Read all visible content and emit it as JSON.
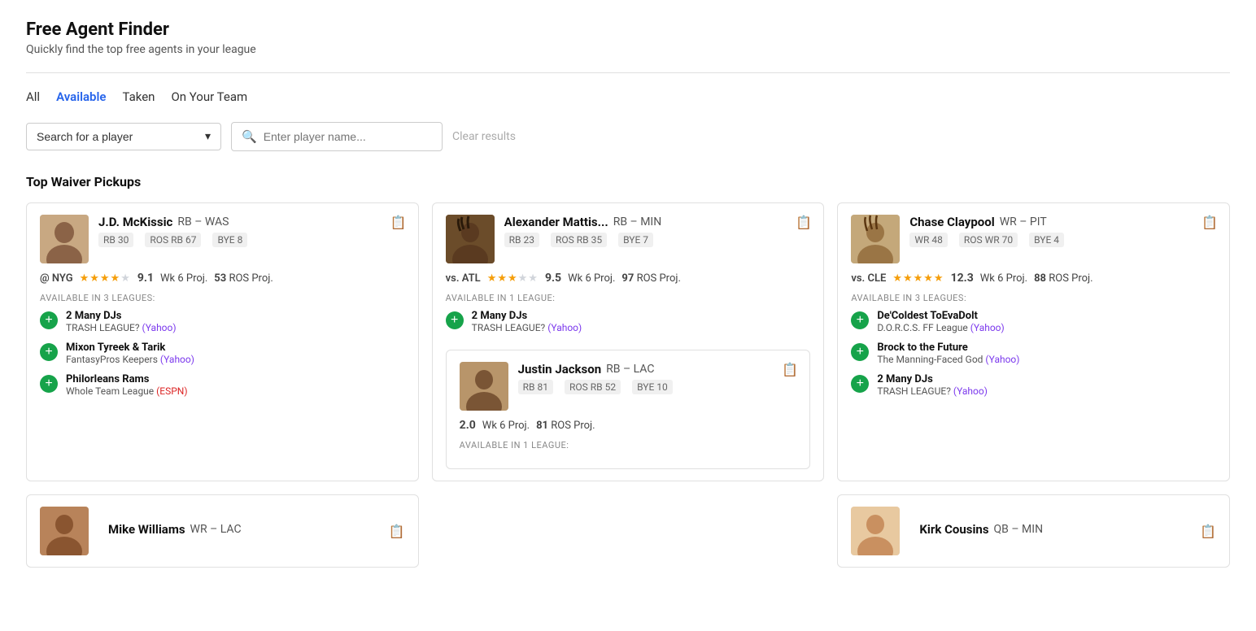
{
  "page": {
    "title": "Free Agent Finder",
    "subtitle": "Quickly find the top free agents in your league"
  },
  "filters": {
    "tabs": [
      {
        "id": "all",
        "label": "All",
        "active": false
      },
      {
        "id": "available",
        "label": "Available",
        "active": true
      },
      {
        "id": "taken",
        "label": "Taken",
        "active": false
      },
      {
        "id": "on-your-team",
        "label": "On Your Team",
        "active": false
      }
    ]
  },
  "search": {
    "player_select_placeholder": "Search for a player",
    "player_name_placeholder": "Enter player name...",
    "clear_label": "Clear results"
  },
  "section": {
    "top_waiver_title": "Top Waiver Pickups"
  },
  "cards": [
    {
      "id": "jd-mckissic",
      "name": "J.D. McKissic",
      "pos": "RB",
      "team": "WAS",
      "stats": [
        "RB 30",
        "ROS RB 67",
        "BYE 8"
      ],
      "matchup": "@ NYG",
      "stars": 4,
      "wk_proj": "9.1",
      "wk_label": "Wk 6 Proj.",
      "ros_proj": "53",
      "ros_label": "ROS Proj.",
      "available_label": "AVAILABLE IN 3 LEAGUES:",
      "leagues": [
        {
          "name": "2 Many DJs",
          "sub_label": "TRASH LEAGUE?",
          "link_text": "Yahoo",
          "link_color": "yahoo"
        },
        {
          "name": "Mixon Tyreek & Tarik",
          "sub_label": "FantasyPros Keepers",
          "link_text": "Yahoo",
          "link_color": "yahoo"
        },
        {
          "name": "Philorleans Rams",
          "sub_label": "Whole Team League",
          "link_text": "ESPN",
          "link_color": "espn"
        }
      ]
    },
    {
      "id": "alexander-mattis",
      "name": "Alexander Mattis...",
      "pos": "RB",
      "team": "MIN",
      "stats": [
        "RB 23",
        "ROS RB 35",
        "BYE 7"
      ],
      "matchup": "vs. ATL",
      "stars": 3,
      "wk_proj": "9.5",
      "wk_label": "Wk 6 Proj.",
      "ros_proj": "97",
      "ros_label": "ROS Proj.",
      "available_label": "AVAILABLE IN 1 LEAGUE:",
      "leagues": [
        {
          "name": "2 Many DJs",
          "sub_label": "TRASH LEAGUE?",
          "link_text": "Yahoo",
          "link_color": "yahoo"
        }
      ]
    },
    {
      "id": "chase-claypool",
      "name": "Chase Claypool",
      "pos": "WR",
      "team": "PIT",
      "stats": [
        "WR 48",
        "ROS WR 70",
        "BYE 4"
      ],
      "matchup": "vs. CLE",
      "stars": 5,
      "wk_proj": "12.3",
      "wk_label": "Wk 6 Proj.",
      "ros_proj": "88",
      "ros_label": "ROS Proj.",
      "available_label": "AVAILABLE IN 3 LEAGUES:",
      "leagues": [
        {
          "name": "De'Coldest ToEvaDolt",
          "sub_label": "D.O.R.C.S. FF League",
          "link_text": "Yahoo",
          "link_color": "yahoo"
        },
        {
          "name": "Brock to the Future",
          "sub_label": "The Manning-Faced God",
          "link_text": "Yahoo",
          "link_color": "yahoo"
        },
        {
          "name": "2 Many DJs",
          "sub_label": "TRASH LEAGUE?",
          "link_text": "Yahoo",
          "link_color": "yahoo"
        }
      ]
    }
  ],
  "bottom_cards": [
    {
      "id": "justin-jackson",
      "name": "Justin Jackson",
      "pos": "RB",
      "team": "LAC",
      "stats": [
        "RB 81",
        "ROS RB 52",
        "BYE 10"
      ],
      "matchup": "",
      "wk_proj": "2.0",
      "wk_label": "Wk 6 Proj.",
      "ros_proj": "81",
      "ros_label": "ROS Proj.",
      "available_label": "AVAILABLE IN 1 LEAGUE:"
    },
    {
      "id": "mike-williams",
      "name": "Mike Williams",
      "pos": "WR",
      "team": "LAC"
    },
    {
      "id": "kirk-cousins",
      "name": "Kirk Cousins",
      "pos": "QB",
      "team": "MIN"
    }
  ],
  "colors": {
    "active_tab": "#2563eb",
    "add_btn": "#16a34a",
    "yahoo_link": "#7c3aed",
    "espn_link": "#dc2626",
    "star_filled": "#f59e0b",
    "star_empty": "#d1d5db"
  }
}
